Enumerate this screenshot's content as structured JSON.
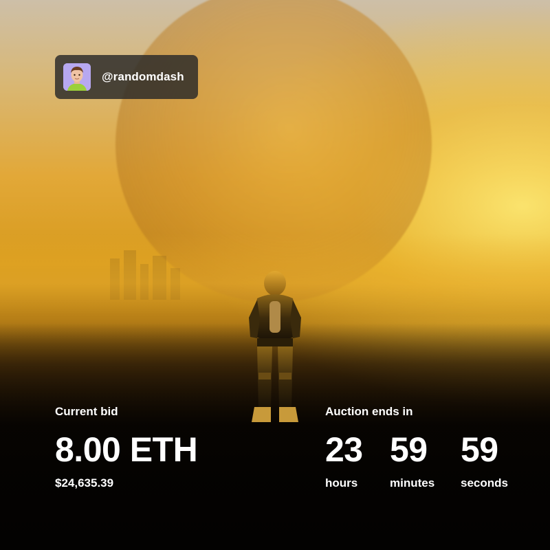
{
  "profile": {
    "handle": "@randomdash",
    "avatar_icon": "avatar-portrait"
  },
  "bid": {
    "label": "Current bid",
    "amount": "8.00 ETH",
    "usd": "$24,635.39"
  },
  "auction": {
    "label": "Auction ends in",
    "countdown": [
      {
        "value": "23",
        "unit": "hours"
      },
      {
        "value": "59",
        "unit": "minutes"
      },
      {
        "value": "59",
        "unit": "seconds"
      }
    ]
  },
  "colors": {
    "chip_background": "#282828",
    "avatar_background": "#b7a8f0",
    "text": "#ffffff",
    "sky_glow": "#f5d23c"
  }
}
